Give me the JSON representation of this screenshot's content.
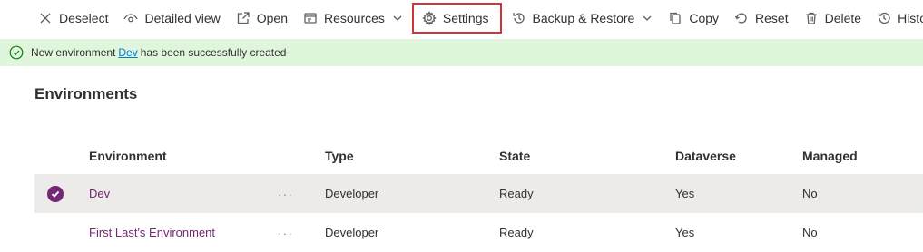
{
  "toolbar": {
    "deselect": "Deselect",
    "detailed_view": "Detailed view",
    "open": "Open",
    "resources": "Resources",
    "settings": "Settings",
    "backup_restore": "Backup & Restore",
    "copy": "Copy",
    "reset": "Reset",
    "delete": "Delete",
    "history": "History"
  },
  "banner": {
    "prefix": "New environment",
    "link": "Dev",
    "suffix": "has been successfully created"
  },
  "section": {
    "title": "Environments"
  },
  "table": {
    "columns": {
      "environment": "Environment",
      "type": "Type",
      "state": "State",
      "dataverse": "Dataverse",
      "managed": "Managed"
    },
    "rows": [
      {
        "environment": "Dev",
        "more": "···",
        "type": "Developer",
        "state": "Ready",
        "dataverse": "Yes",
        "managed": "No"
      },
      {
        "environment": "First Last's Environment",
        "more": "···",
        "type": "Developer",
        "state": "Ready",
        "dataverse": "Yes",
        "managed": "No"
      }
    ]
  },
  "colors": {
    "accent": "#742774",
    "success_bg": "#dff6dd",
    "success_icon": "#107c10",
    "link": "#0078d4",
    "highlight_border": "#d13438",
    "selected_row": "#edebe9"
  }
}
